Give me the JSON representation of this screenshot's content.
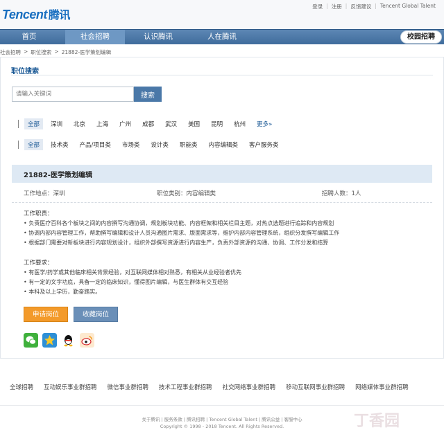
{
  "header": {
    "logo_text": "Tencent",
    "logo_cn": "腾讯",
    "links": [
      "登录",
      "注册",
      "反馈建议",
      "Tencent Global Talent"
    ]
  },
  "nav": {
    "items": [
      "首页",
      "社会招聘",
      "认识腾讯",
      "人在腾讯"
    ],
    "active_index": 1,
    "campus": "校园招聘"
  },
  "breadcrumb": [
    "社会招聘",
    "职位搜索",
    "21882-医学策划编辑"
  ],
  "search": {
    "section_title": "职位搜索",
    "placeholder": "请输入关键词",
    "button": "搜索"
  },
  "filters": {
    "cities": [
      "全部",
      "深圳",
      "北京",
      "上海",
      "广州",
      "成都",
      "武汉",
      "美国",
      "昆明",
      "杭州"
    ],
    "more": "更多",
    "categories": [
      "全部",
      "技术类",
      "产品/项目类",
      "市场类",
      "设计类",
      "职能类",
      "内容编辑类",
      "客户服务类"
    ]
  },
  "job": {
    "title": "21882-医学策划编辑",
    "location": "工作地点：深圳",
    "category": "职位类别：内容编辑类",
    "headcount": "招聘人数：1人",
    "duties_title": "工作职责：",
    "duties": [
      "负责医疗百科各个板块之间的内容撰写沟通协调，规划板块功能、内容框架和相关栏目主题，对热点选题进行追踪和内容规划",
      "协调内部内容管理工作，帮助撰写编辑和设计人员沟通图片需求、版面需求等，维护内部内容管理系统，组织分发撰写编辑工作",
      "根据部门需要对新板块进行内容规划设计，组织外部撰写资源进行内容生产，负责外部资源的沟通、协调、工作分发和结算"
    ],
    "req_title": "工作要求：",
    "requirements": [
      "有医学/药学或其他临床相关背景经验，对互联网媒体相对熟悉，有相关从业经验者优先",
      "有一定的文字功底，具备一定的临床知识，懂得图片编辑，与医生群体有交互经验",
      "本科及以上学历，勤奋踏实。"
    ],
    "apply": "申请岗位",
    "favorite": "收藏岗位"
  },
  "share_icons": [
    "wechat-icon",
    "qzone-icon",
    "qq-icon",
    "weibo-icon"
  ],
  "footer": {
    "groups": [
      "全球招聘",
      "互动娱乐事业群招聘",
      "微信事业群招聘",
      "技术工程事业群招聘",
      "社交网络事业群招聘",
      "移动互联网事业群招聘",
      "网络媒体事业群招聘"
    ],
    "links": "关于腾讯 | 服务条款 | 腾讯招聘 | Tencent Global Talent | 腾讯公益 | 客服中心",
    "copyright": "Copyright © 1998 - 2018 Tencent. All Rights Reserved.",
    "watermark": "丁香园"
  }
}
